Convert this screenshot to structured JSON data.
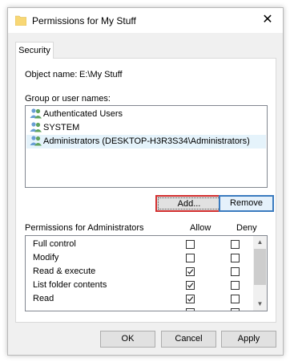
{
  "window": {
    "title": "Permissions for My Stuff",
    "close_symbol": "✕"
  },
  "tabs": [
    {
      "label": "Security"
    }
  ],
  "object": {
    "label": "Object name:",
    "value": "E:\\My Stuff"
  },
  "group": {
    "label": "Group or user names:",
    "users": [
      {
        "name": "Authenticated Users",
        "icon": "users-icon",
        "selected": false
      },
      {
        "name": "SYSTEM",
        "icon": "users-icon",
        "selected": false
      },
      {
        "name": "Administrators (DESKTOP-H3R3S34\\Administrators)",
        "icon": "users-icon",
        "selected": true
      }
    ]
  },
  "buttons": {
    "add": "Add...",
    "remove": "Remove",
    "ok": "OK",
    "cancel": "Cancel",
    "apply": "Apply"
  },
  "permissions": {
    "label": "Permissions for Administrators",
    "allow_header": "Allow",
    "deny_header": "Deny",
    "rows": [
      {
        "name": "Full control",
        "allow": false,
        "deny": false
      },
      {
        "name": "Modify",
        "allow": false,
        "deny": false
      },
      {
        "name": "Read & execute",
        "allow": true,
        "deny": false
      },
      {
        "name": "List folder contents",
        "allow": true,
        "deny": false
      },
      {
        "name": "Read",
        "allow": true,
        "deny": false
      }
    ]
  },
  "colors": {
    "add_highlight": "#d32f2f",
    "remove_focus": "#3b7bbf",
    "selection": "#e5f3fb",
    "folder": "#f8d775"
  }
}
